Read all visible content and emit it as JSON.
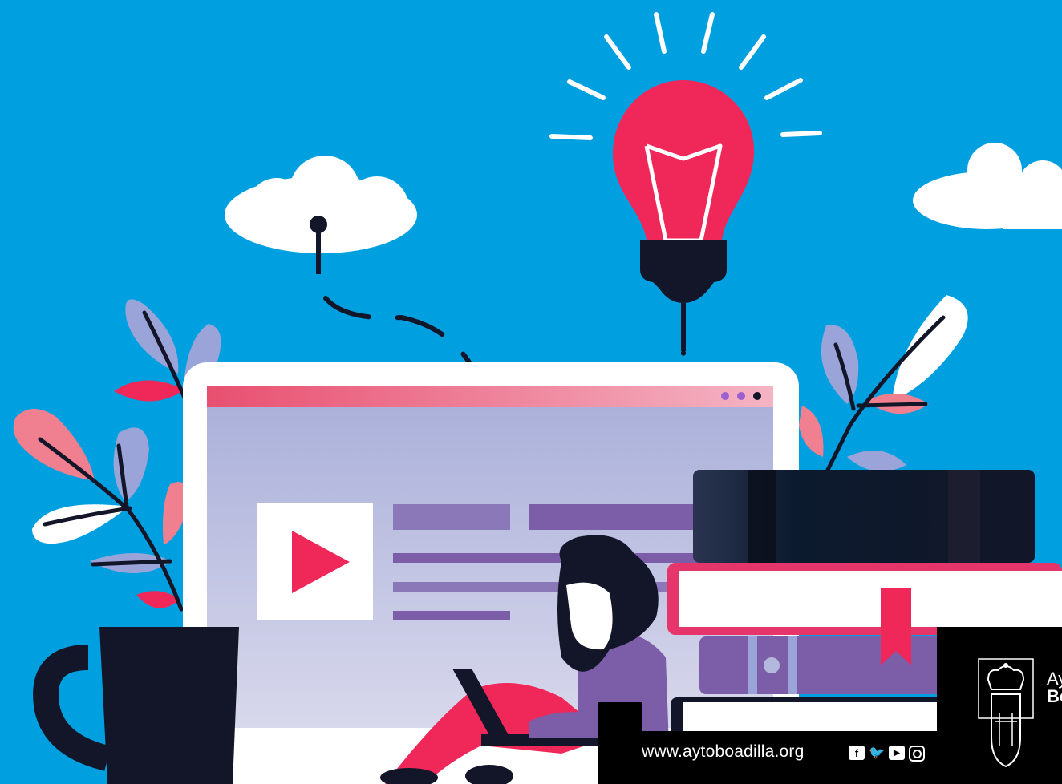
{
  "footer": {
    "website": "www.aytoboadilla.org",
    "socials": [
      "facebook-icon",
      "twitter-icon",
      "youtube-icon",
      "instagram-icon"
    ],
    "facebook_glyph": "f",
    "twitter_glyph": "🐦",
    "youtube_glyph": "▶"
  },
  "logo": {
    "line1": "Ay",
    "line2": "Bo"
  },
  "colors": {
    "sky": "#00A0E0",
    "bulb": "#F0285A",
    "screen": "#B4B8DC",
    "purple": "#7B5EA7",
    "navy": "#121628",
    "footer": "#000000"
  }
}
